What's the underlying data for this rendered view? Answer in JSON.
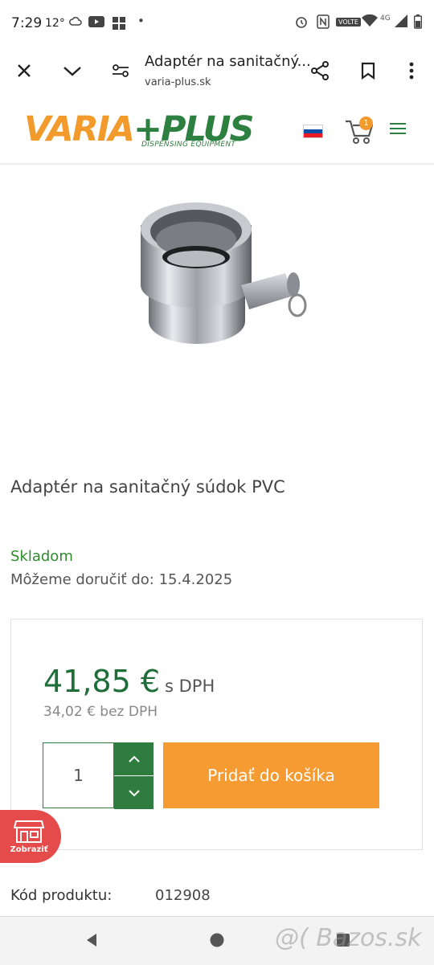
{
  "status_bar": {
    "time": "7:29",
    "temperature": "12°",
    "dot": "•",
    "volte": "VOLTE",
    "network": "4G",
    "icons_left": [
      "cloud-icon",
      "youtube-icon",
      "grid-icon"
    ],
    "icons_right": [
      "alarm-icon",
      "nfc-icon",
      "volte-icon",
      "wifi-icon",
      "signal-icon",
      "battery-icon"
    ]
  },
  "browser": {
    "page_title": "Adaptér na sanitačný...",
    "url": "varia-plus.sk",
    "icons": [
      "close-icon",
      "chevron-down-icon",
      "tune-icon",
      "share-icon",
      "bookmark-icon",
      "more-icon"
    ]
  },
  "header": {
    "logo_varia": "VARIA",
    "logo_plus": "+PLUS",
    "logo_tagline": "DISPENSING EQUIPMENT",
    "cart_count": "1",
    "flag_colors": [
      "#ffffff",
      "#0b4ea2",
      "#ee1c25"
    ],
    "brand_orange": "#f39a2d",
    "brand_green": "#2e8040"
  },
  "product": {
    "title": "Adaptér na sanitačný súdok PVC",
    "stock_status": "Skladom",
    "delivery_label": "Môžeme doručiť do:",
    "delivery_date": "15.4.2025",
    "price": "41,85 €",
    "price_vat_label": "s DPH",
    "price_net": "34,02 € bez DPH",
    "quantity": "1",
    "add_to_cart": "Pridať do košíka",
    "code_label": "Kód produktu:",
    "code_value": "012908"
  },
  "floating": {
    "label": "Zobraziť",
    "color": "#e64b4b"
  },
  "watermark": "@( Bazos.sk"
}
